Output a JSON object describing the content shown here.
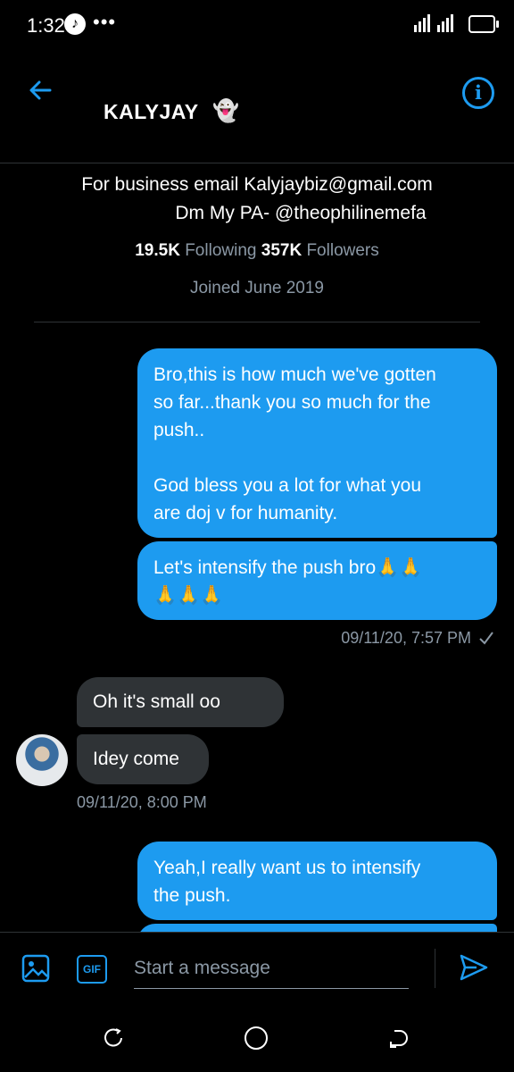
{
  "status_bar": {
    "time": "1:32",
    "dots": "•••"
  },
  "header": {
    "title": "KALYJAY",
    "emoji": "👻"
  },
  "profile": {
    "bio_line1": "For business email  Kalyjaybiz@gmail.com",
    "bio_line2": "Dm My PA- @theophilinemefa",
    "following_count": "19.5K",
    "following_label": "Following",
    "followers_count": "357K",
    "followers_label": "Followers",
    "joined": "Joined June 2019"
  },
  "messages": {
    "out1_line1": "Bro,this is how much we've gotten",
    "out1_line2": "so far...thank you so much for the",
    "out1_line3": "push..",
    "out1_line4": "God bless you a lot for what you",
    "out1_line5": "are doj v for humanity.",
    "out2_line1": "Let's intensify the push bro🙏🙏",
    "out2_line2": "🙏🙏🙏",
    "out_time1": "09/11/20, 7:57 PM",
    "in1": "Oh it's small oo",
    "in2": "Idey come",
    "in_time": "09/11/20, 8:00 PM",
    "out3_line1": "Yeah,I really want us to intensify",
    "out3_line2": "the push."
  },
  "compose": {
    "placeholder": "Start a message",
    "gif_label": "GIF"
  },
  "colors": {
    "accent": "#1d9bf0",
    "incoming_bubble": "#2f3336",
    "background": "#000000",
    "muted": "#8b98a5"
  }
}
